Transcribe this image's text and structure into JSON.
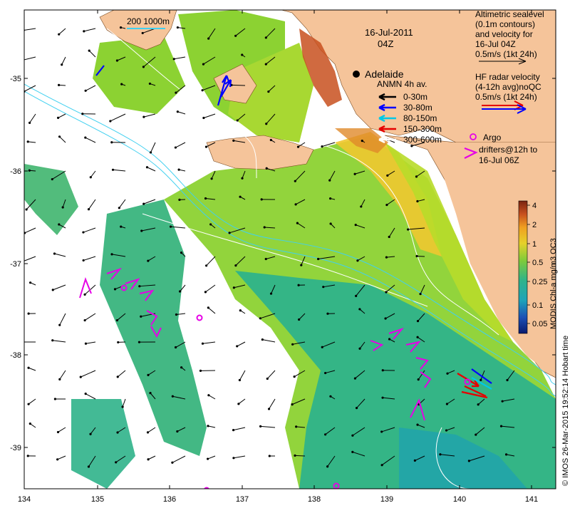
{
  "map": {
    "date": "16-Jul-2011",
    "hour": "04Z",
    "place_label": "Adelaide",
    "scalebar_label": "200  1000m",
    "credit": "© IMOS 26-Mar-2015 19:52:14 Hobart time",
    "colorbar_title": "MODIS Chl-a mg/m3 OC3",
    "colorbar_ticks": [
      "4",
      "2",
      "1",
      "0.5",
      "0.25",
      "0.1",
      "0.05"
    ],
    "x_ticks": [
      "134",
      "135",
      "136",
      "137",
      "138",
      "139",
      "140",
      "141"
    ],
    "y_ticks": [
      "-35",
      "-36",
      "-37",
      "-38",
      "-39"
    ],
    "colors": {
      "land": "#f5c49a",
      "ocean_cloud": "#ffffff",
      "chl_high": "#a0461e",
      "chl_mid": "#8cd232",
      "chl_low": "#2fb38a",
      "chl_vlow": "#23a6a6"
    }
  },
  "legend": {
    "altimetric_lines": [
      "Altimetric sealevel",
      "(0.1m contours)",
      "and velocity for",
      "16-Jul 04Z",
      "0.5m/s (1kt 24h)"
    ],
    "hf_radar_lines": [
      "HF radar velocity",
      "(4-12h avg)noQC",
      "0.5m/s (1kt 24h)"
    ],
    "anmn_title": "ANMN 4h av.",
    "anmn_items": [
      {
        "label": "0-30m",
        "color": "#000000"
      },
      {
        "label": "30-80m",
        "color": "#0000ff"
      },
      {
        "label": "80-150m",
        "color": "#00c8e6"
      },
      {
        "label": "150-300m",
        "color": "#e60000"
      },
      {
        "label": "300-600m",
        "color": "#ffffff"
      }
    ],
    "argo_lines": [
      "Argo",
      "drifters@12h to",
      "16-Jul 06Z"
    ],
    "argo_color": "#e600e6"
  }
}
